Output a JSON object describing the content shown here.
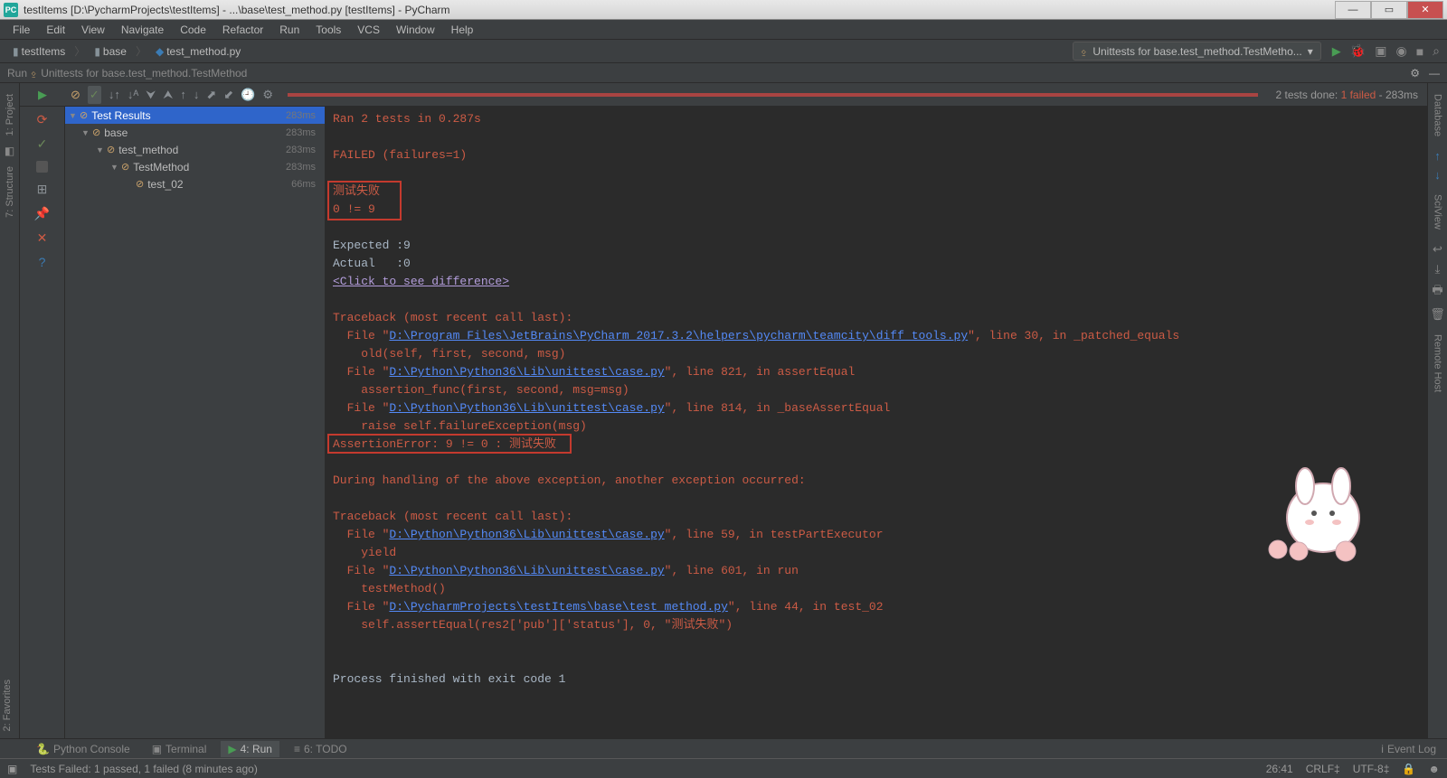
{
  "title": "testItems [D:\\PycharmProjects\\testItems] - ...\\base\\test_method.py [testItems] - PyCharm",
  "menu": [
    "File",
    "Edit",
    "View",
    "Navigate",
    "Code",
    "Refactor",
    "Run",
    "Tools",
    "VCS",
    "Window",
    "Help"
  ],
  "breadcrumb": {
    "root": "testItems",
    "folder": "base",
    "file": "test_method.py"
  },
  "run_config": "Unittests for base.test_method.TestMetho...",
  "run_label": "Run",
  "run_target": "Unittests for base.test_method.TestMethod",
  "status": {
    "done": "2 tests done:",
    "failed": "1 failed",
    "elapsed": "- 283ms"
  },
  "tree": {
    "root": {
      "label": "Test Results",
      "time": "283ms"
    },
    "base": {
      "label": "base",
      "time": "283ms"
    },
    "method": {
      "label": "test_method",
      "time": "283ms"
    },
    "class": {
      "label": "TestMethod",
      "time": "283ms"
    },
    "test": {
      "label": "test_02",
      "time": "66ms"
    }
  },
  "console": {
    "l1": "Ran 2 tests in 0.287s",
    "l2": "FAILED (failures=1)",
    "l3": "测试失败",
    "l4": "0 != 9",
    "l5": "Expected :9",
    "l6": "Actual   :0",
    "l7": "<Click to see difference>",
    "l8": "Traceback (most recent call last):",
    "l9a": "  File \"",
    "l9b": "D:\\Program Files\\JetBrains\\PyCharm 2017.3.2\\helpers\\pycharm\\teamcity\\diff_tools.py",
    "l9c": "\", line 30, in _patched_equals",
    "l10": "    old(self, first, second, msg)",
    "l11a": "  File \"",
    "l11b": "D:\\Python\\Python36\\Lib\\unittest\\case.py",
    "l11c": "\", line 821, in assertEqual",
    "l12": "    assertion_func(first, second, msg=msg)",
    "l13a": "  File \"",
    "l13b": "D:\\Python\\Python36\\Lib\\unittest\\case.py",
    "l13c": "\", line 814, in _baseAssertEqual",
    "l14": "    raise self.failureException(msg)",
    "l15": "AssertionError: 9 != 0 : 测试失败",
    "l16": "During handling of the above exception, another exception occurred:",
    "l17": "Traceback (most recent call last):",
    "l18a": "  File \"",
    "l18b": "D:\\Python\\Python36\\Lib\\unittest\\case.py",
    "l18c": "\", line 59, in testPartExecutor",
    "l19": "    yield",
    "l20a": "  File \"",
    "l20b": "D:\\Python\\Python36\\Lib\\unittest\\case.py",
    "l20c": "\", line 601, in run",
    "l21": "    testMethod()",
    "l22a": "  File \"",
    "l22b": "D:\\PycharmProjects\\testItems\\base\\test_method.py",
    "l22c": "\", line 44, in test_02",
    "l23": "    self.assertEqual(res2['pub']['status'], 0, \"测试失败\")",
    "l24": "Process finished with exit code 1"
  },
  "bottom": {
    "python_console": "Python Console",
    "terminal": "Terminal",
    "run": "4: Run",
    "todo": "6: TODO",
    "event_log": "Event Log"
  },
  "status_msg": "Tests Failed: 1 passed, 1 failed (8 minutes ago)",
  "cursor": "26:41",
  "line_end": "CRLF‡",
  "encoding": "UTF-8‡",
  "left_tabs": {
    "project": "1: Project",
    "structure": "7: Structure",
    "favorites": "2: Favorites"
  },
  "right_tabs": {
    "database": "Database",
    "sciview": "SciView",
    "remote": "Remote Host"
  }
}
